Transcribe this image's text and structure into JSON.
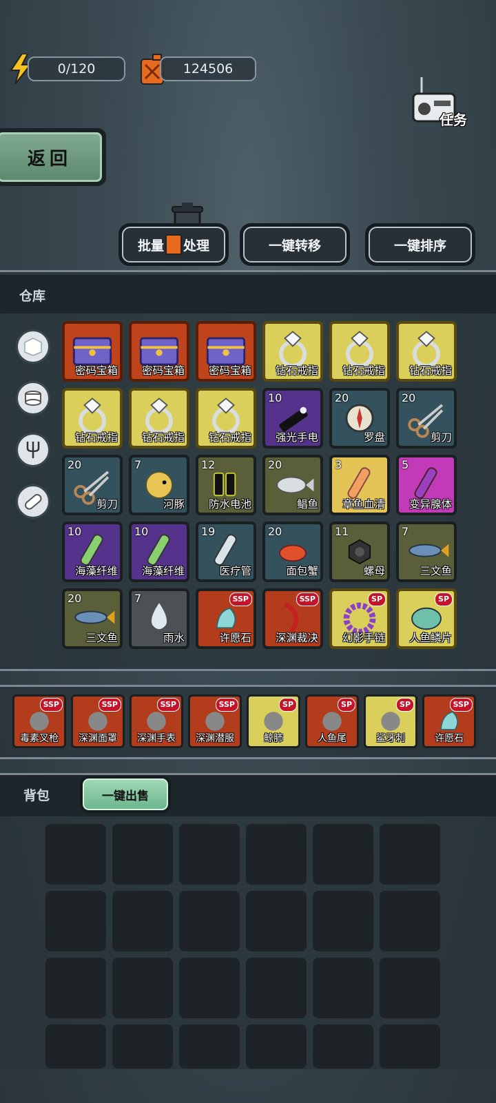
{
  "resources": {
    "energy": "0/120",
    "fuel": "124506"
  },
  "task_label": "任务",
  "back_label": "返回",
  "actions": {
    "batch_a": "批量",
    "batch_b": "处理",
    "transfer": "一键转移",
    "sort": "一键排序"
  },
  "warehouse": {
    "title": "仓库",
    "categories": [
      "box-icon",
      "can-icon",
      "fork-icon",
      "pill-icon"
    ],
    "items": [
      {
        "name": "密码宝箱",
        "qty": "",
        "rarity": "chest"
      },
      {
        "name": "密码宝箱",
        "qty": "",
        "rarity": "chest"
      },
      {
        "name": "密码宝箱",
        "qty": "",
        "rarity": "chest"
      },
      {
        "name": "钻石戒指",
        "qty": "",
        "rarity": "gold"
      },
      {
        "name": "钻石戒指",
        "qty": "",
        "rarity": "gold"
      },
      {
        "name": "钻石戒指",
        "qty": "",
        "rarity": "gold"
      },
      {
        "name": "钻石戒指",
        "qty": "",
        "rarity": "gold"
      },
      {
        "name": "钻石戒指",
        "qty": "",
        "rarity": "gold"
      },
      {
        "name": "钻石戒指",
        "qty": "",
        "rarity": "gold"
      },
      {
        "name": "强光手电",
        "qty": "10",
        "rarity": "purple"
      },
      {
        "name": "罗盘",
        "qty": "20",
        "rarity": "blue"
      },
      {
        "name": "剪刀",
        "qty": "20",
        "rarity": "blue"
      },
      {
        "name": "剪刀",
        "qty": "20",
        "rarity": "blue"
      },
      {
        "name": "河豚",
        "qty": "7",
        "rarity": "blue"
      },
      {
        "name": "防水电池",
        "qty": "12",
        "rarity": "olive"
      },
      {
        "name": "鲳鱼",
        "qty": "20",
        "rarity": "olive"
      },
      {
        "name": "章鱼血清",
        "qty": "3",
        "rarity": "orangeY"
      },
      {
        "name": "变异腺体",
        "qty": "5",
        "rarity": "pink"
      },
      {
        "name": "海藻纤维",
        "qty": "10",
        "rarity": "purple"
      },
      {
        "name": "海藻纤维",
        "qty": "10",
        "rarity": "purple"
      },
      {
        "name": "医疗管",
        "qty": "19",
        "rarity": "blue"
      },
      {
        "name": "面包蟹",
        "qty": "20",
        "rarity": "blue"
      },
      {
        "name": "螺母",
        "qty": "11",
        "rarity": "olive"
      },
      {
        "name": "三文鱼",
        "qty": "7",
        "rarity": "olive"
      },
      {
        "name": "三文鱼",
        "qty": "20",
        "rarity": "olive"
      },
      {
        "name": "雨水",
        "qty": "7",
        "rarity": "lightgray"
      },
      {
        "name": "许愿石",
        "qty": "",
        "rarity": "red",
        "badge": "SSP"
      },
      {
        "name": "深渊裁决",
        "qty": "",
        "rarity": "red",
        "badge": "SSP"
      },
      {
        "name": "幻影手链",
        "qty": "",
        "rarity": "gold",
        "badge": "SP"
      },
      {
        "name": "人鱼鳞片",
        "qty": "",
        "rarity": "gold",
        "badge": "SP"
      }
    ]
  },
  "equipment": [
    {
      "name": "毒素叉枪",
      "badge": "SSP",
      "rarity": "red"
    },
    {
      "name": "深渊面罩",
      "badge": "SSP",
      "rarity": "red"
    },
    {
      "name": "深渊手表",
      "badge": "SSP",
      "rarity": "red"
    },
    {
      "name": "深渊潜服",
      "badge": "SSP",
      "rarity": "red"
    },
    {
      "name": "鲸肺",
      "badge": "SP",
      "rarity": "gold"
    },
    {
      "name": "人鱼尾",
      "badge": "SP",
      "rarity": "red"
    },
    {
      "name": "鲨牙刺",
      "badge": "SP",
      "rarity": "gold"
    },
    {
      "name": "许愿石",
      "badge": "SSP",
      "rarity": "red"
    }
  ],
  "backpack": {
    "title": "背包",
    "sell_label": "一键出售"
  }
}
